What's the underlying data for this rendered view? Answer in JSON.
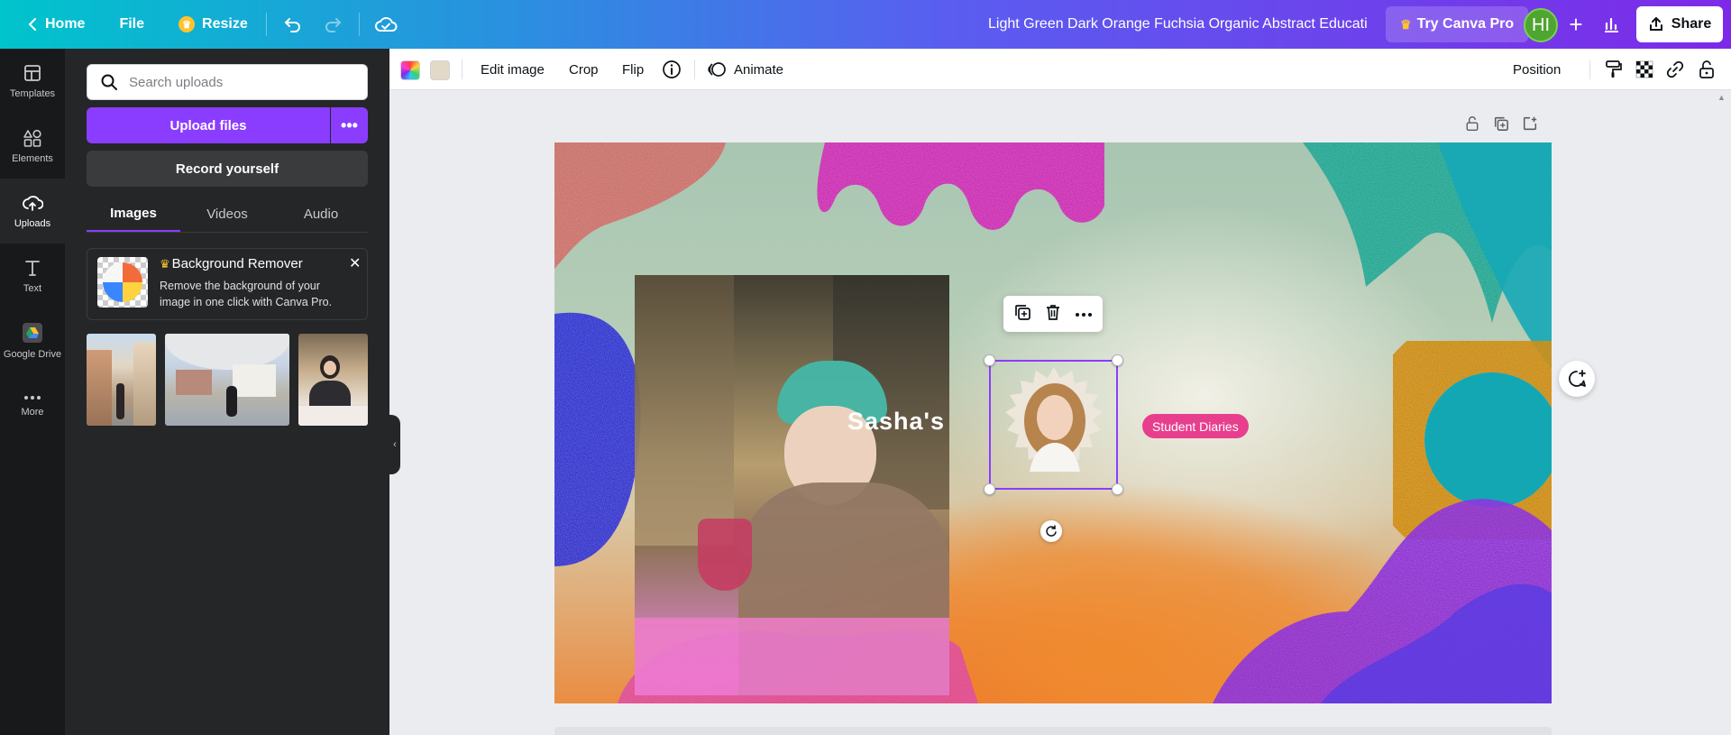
{
  "topbar": {
    "home_label": "Home",
    "file_label": "File",
    "resize_label": "Resize",
    "design_title": "Light Green Dark Orange Fuchsia Organic Abstract Educatio...",
    "try_pro_label": "Try Canva Pro",
    "avatar_initials": "HI",
    "share_label": "Share"
  },
  "rail": {
    "items": [
      {
        "label": "Templates",
        "icon": "templates-icon"
      },
      {
        "label": "Elements",
        "icon": "elements-icon"
      },
      {
        "label": "Uploads",
        "icon": "uploads-icon"
      },
      {
        "label": "Text",
        "icon": "text-icon"
      },
      {
        "label": "Google Drive",
        "icon": "google-drive-icon"
      },
      {
        "label": "More",
        "icon": "more-icon"
      }
    ]
  },
  "panel": {
    "search_placeholder": "Search uploads",
    "upload_label": "Upload files",
    "record_label": "Record yourself",
    "tabs": [
      "Images",
      "Videos",
      "Audio"
    ],
    "promo": {
      "title": "Background Remover",
      "description": "Remove the background of your image in one click with Canva Pro."
    }
  },
  "context_toolbar": {
    "edit_image_label": "Edit image",
    "crop_label": "Crop",
    "flip_label": "Flip",
    "animate_label": "Animate",
    "position_label": "Position",
    "swatch_colors": [
      "#ffffff",
      "#e3d9c8"
    ]
  },
  "canvas": {
    "heading_text": "Sasha's",
    "tag_text": "Student Diaries"
  },
  "colors": {
    "accent": "#8b3dff",
    "tag_pink": "#e73f8d"
  }
}
